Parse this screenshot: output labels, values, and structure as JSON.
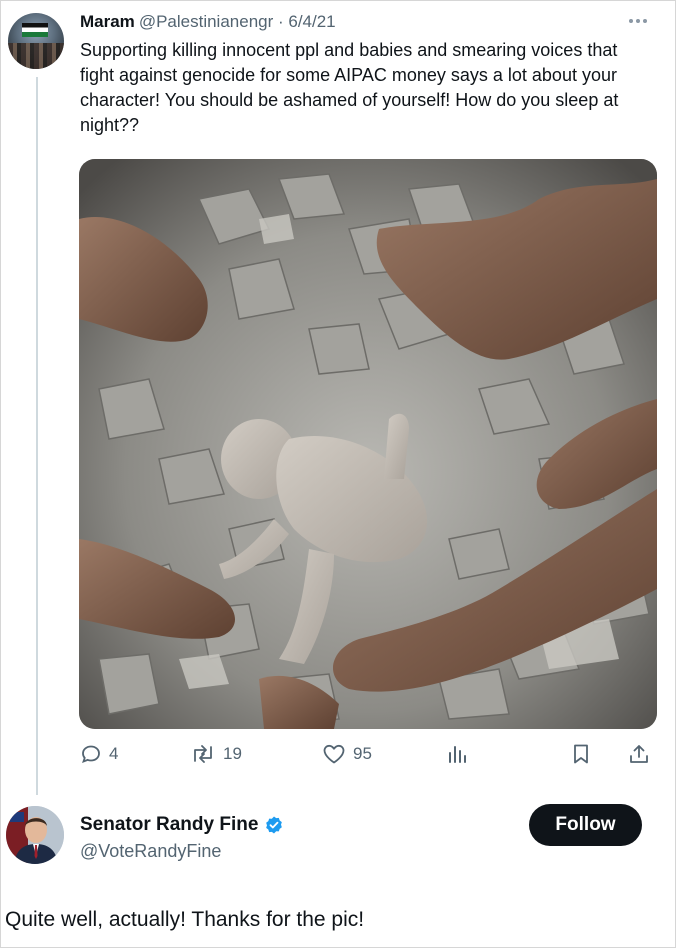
{
  "tweet1": {
    "author_name": "Maram",
    "handle_and_date": "@Palestinianengr · 6/4/21",
    "text": "Supporting killing innocent ppl and babies and smearing voices that fight against genocide for some AIPAC money says a lot about your character! You should be ashamed of yourself! How do you sleep at night??",
    "media_icon": "photo",
    "actions": {
      "reply_count": "4",
      "retweet_count": "19",
      "like_count": "95"
    }
  },
  "tweet2": {
    "author_name": "Senator Randy Fine",
    "handle": "@VoteRandyFine",
    "follow_label": "Follow",
    "text": "Quite well, actually!  Thanks for the pic!"
  },
  "colors": {
    "text_primary": "#0f1419",
    "text_secondary": "#536471",
    "verified_blue": "#1d9bf0",
    "follow_bg": "#0f1419"
  }
}
